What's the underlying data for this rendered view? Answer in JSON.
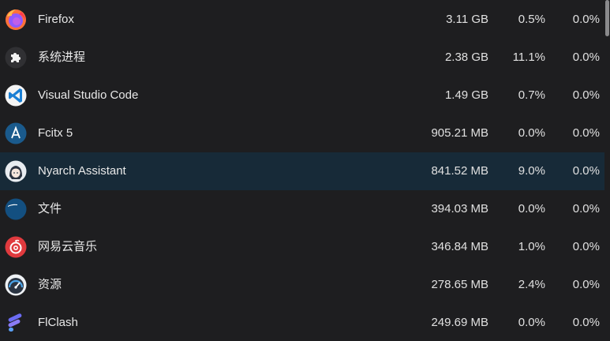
{
  "processes": [
    {
      "name": "Firefox",
      "memory": "3.11 GB",
      "cpu": "0.5%",
      "io": "0.0%",
      "icon": "firefox-icon"
    },
    {
      "name": "系统进程",
      "memory": "2.38 GB",
      "cpu": "11.1%",
      "io": "0.0%",
      "icon": "puzzle-piece-icon"
    },
    {
      "name": "Visual Studio Code",
      "memory": "1.49 GB",
      "cpu": "0.7%",
      "io": "0.0%",
      "icon": "vscode-icon"
    },
    {
      "name": "Fcitx 5",
      "memory": "905.21 MB",
      "cpu": "0.0%",
      "io": "0.0%",
      "icon": "fcitx-icon"
    },
    {
      "name": "Nyarch Assistant",
      "memory": "841.52 MB",
      "cpu": "9.0%",
      "io": "0.0%",
      "icon": "nyarch-assistant-icon",
      "selected": true
    },
    {
      "name": "文件",
      "memory": "394.03 MB",
      "cpu": "0.0%",
      "io": "0.0%",
      "icon": "files-icon"
    },
    {
      "name": "网易云音乐",
      "memory": "346.84 MB",
      "cpu": "1.0%",
      "io": "0.0%",
      "icon": "netease-music-icon"
    },
    {
      "name": "资源",
      "memory": "278.65 MB",
      "cpu": "2.4%",
      "io": "0.0%",
      "icon": "resources-gauge-icon"
    },
    {
      "name": "FlClash",
      "memory": "249.69 MB",
      "cpu": "0.0%",
      "io": "0.0%",
      "icon": "flclash-icon"
    }
  ],
  "colors": {
    "background": "#1e1e20",
    "selected_row": "#172a38",
    "text": "#e6e6e6",
    "scrollbar_thumb": "#8a8a8c"
  }
}
